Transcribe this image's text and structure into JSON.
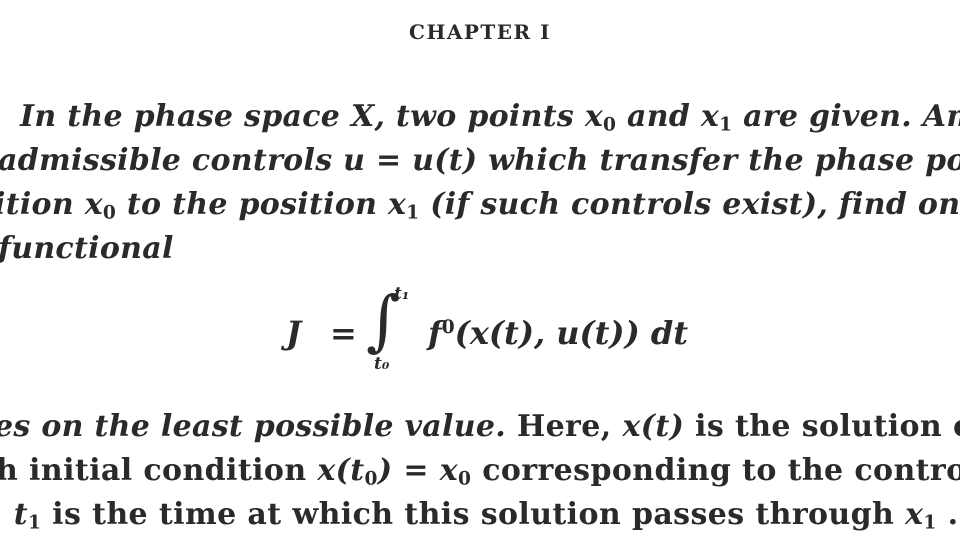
{
  "chapter": {
    "heading": "CHAPTER I"
  },
  "paragraph_italic": {
    "line1": {
      "a": "In the phase space X, two points x",
      "a_sub": "0",
      "b": " and x",
      "b_sub": "1",
      "c": " are given.   Amon"
    },
    "line2": {
      "text": "admissible controls u = u(t) which transfer the phase point fron"
    },
    "line3": {
      "a": "ition x",
      "a_sub": "0",
      "b": " to the position x",
      "b_sub": "1",
      "c": " (if such controls exist), find one for u"
    },
    "line4": {
      "text": "functional"
    }
  },
  "formula": {
    "lhs": "J",
    "equals": "=",
    "integral": "∫",
    "upper_limit": "t₁",
    "lower_limit": "t₀",
    "integrand_f": "f",
    "integrand_sup": "0",
    "integrand_rest": "(x(t), u(t)) dt"
  },
  "paragraph_roman": {
    "line6": {
      "ital": "es on the least possible value.",
      "a": "   Here, ",
      "x_t": "x(t)",
      "b": " is the solution of eq"
    },
    "line7": {
      "a": "h initial condition ",
      "x_t0_a": "x(t",
      "x_t0_sub": "0",
      "x_t0_b": ")",
      "eq": " = ",
      "x0": "x",
      "x0_sub": "0",
      "b": " corresponding to the control "
    },
    "line8": {
      "a": ", ",
      "t1": "t",
      "t1_sub": "1",
      "b": " is the time at which this solution passes through ",
      "x1": "x",
      "x1_sub": "1",
      "c": " ."
    }
  }
}
